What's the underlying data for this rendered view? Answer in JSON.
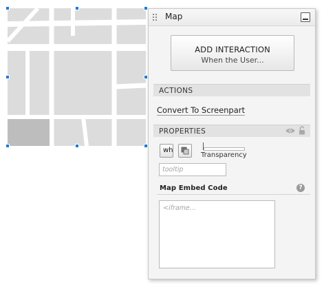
{
  "canvas": {
    "map_widget": {
      "selected": true,
      "colors": {
        "block": "#dcdcdc",
        "street": "#ffffff",
        "highlighted_block": "#bdbdbd",
        "selection": "#1e7ad8"
      }
    }
  },
  "panel": {
    "title": "Map",
    "collapse_icon": "minimize-icon",
    "add_interaction": {
      "title": "ADD INTERACTION",
      "subtitle": "When the User..."
    },
    "actions": {
      "header": "ACTIONS",
      "convert_link": "Convert To Screenpart"
    },
    "properties": {
      "header": "PROPERTIES",
      "icons": [
        "eye-icon",
        "lock-icon"
      ],
      "text_size_icon": "wh",
      "transparency_label": "Transparency",
      "transparency_value": 0,
      "tooltip_placeholder": "tooltip",
      "embed_label": "Map Embed Code",
      "embed_placeholder": "<iframe..."
    }
  }
}
